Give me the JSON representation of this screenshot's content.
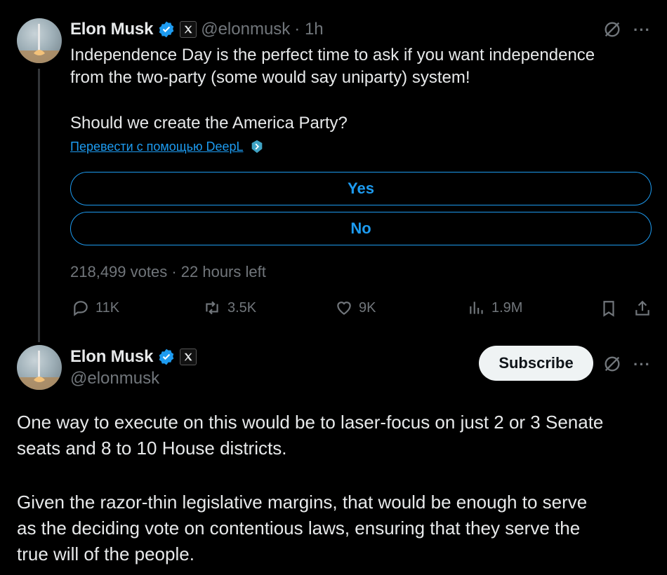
{
  "tweet1": {
    "author": {
      "name": "Elon Musk",
      "handle": "@elonmusk",
      "time": "· 1h"
    },
    "text_lines": [
      "Independence Day is the perfect time to ask if you want independence",
      "from the two-party (some would say uniparty) system!",
      "",
      "Should we create the America Party?"
    ],
    "translate_label": "Перевести с помощью DeepL",
    "poll": {
      "options": [
        "Yes",
        "No"
      ],
      "meta": "218,499 votes · 22 hours left"
    },
    "actions": {
      "replies": "11K",
      "reposts": "3.5K",
      "likes": "9K",
      "views": "1.9M"
    },
    "more_label": "···"
  },
  "tweet2": {
    "author": {
      "name": "Elon Musk",
      "handle": "@elonmusk"
    },
    "subscribe_label": "Subscribe",
    "more_label": "···",
    "text_lines": [
      "One way to execute on this would be to laser-focus on just 2 or 3 Senate",
      "seats and 8 to 10 House districts.",
      "",
      "Given the razor-thin legislative margins, that would be enough to serve",
      "as the deciding vote on contentious laws, ensuring that they serve the",
      "true will of the people."
    ]
  },
  "colors": {
    "accent": "#1d9bf0",
    "muted": "#71767b",
    "text": "#e7e9ea",
    "background": "#000000"
  }
}
